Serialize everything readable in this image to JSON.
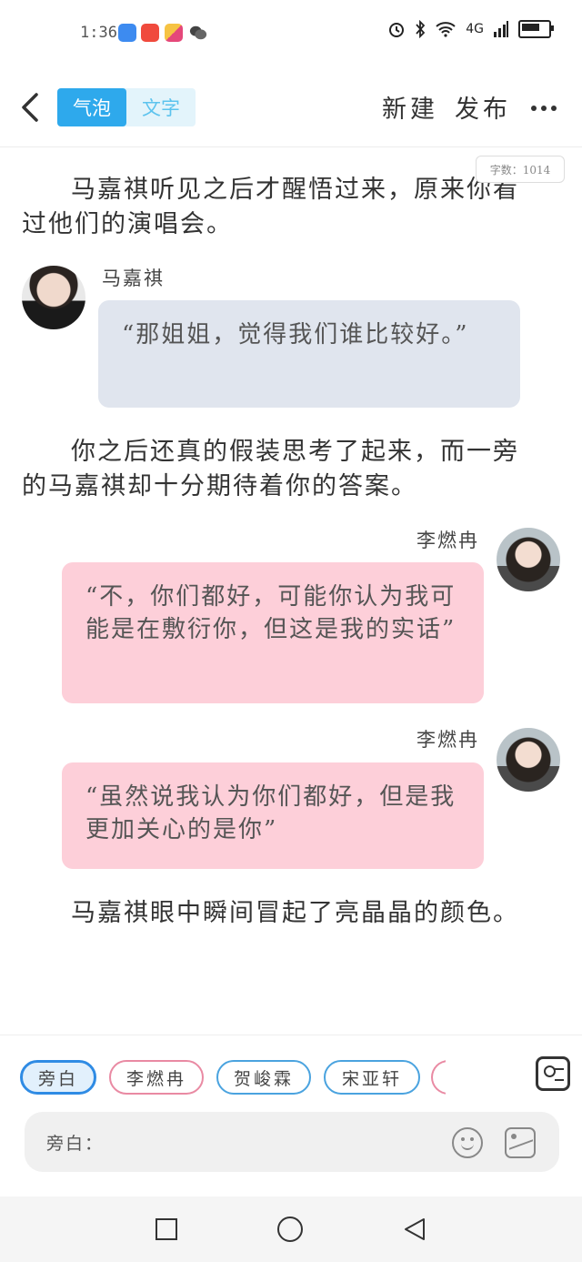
{
  "status_bar": {
    "time": "1:36",
    "network": "4G",
    "battery_level": 0.8
  },
  "header": {
    "mode_tabs": [
      {
        "label": "气泡",
        "active": true
      },
      {
        "label": "文字",
        "active": false
      }
    ],
    "new_label": "新建",
    "publish_label": "发布"
  },
  "word_count": "字数：1014",
  "content": {
    "narration_1": "马嘉祺听见之后才醒悟过来，原来你看过他们的演唱会。",
    "msg_1": {
      "speaker": "马嘉祺",
      "text": "“那姐姐，觉得我们谁比较好。”"
    },
    "narration_2": "你之后还真的假装思考了起来，而一旁的马嘉祺却十分期待着你的答案。",
    "msg_2": {
      "speaker": "李燃冉",
      "text": "“不，你们都好，可能你认为我可能是在敷衍你，但这是我的实话”"
    },
    "msg_3": {
      "speaker": "李燃冉",
      "text": "“虽然说我认为你们都好，但是我更加关心的是你”"
    },
    "narration_3": "马嘉祺眼中瞬间冒起了亮晶晶的颜色。"
  },
  "roles": [
    "旁白",
    "李燃冉",
    "贺峻霖",
    "宋亚轩"
  ],
  "input": {
    "label": "旁白："
  },
  "colors": {
    "accent": "#2ea9ec",
    "bubble_blue": "#e0e5ee",
    "bubble_pink": "#fdcfd9"
  }
}
